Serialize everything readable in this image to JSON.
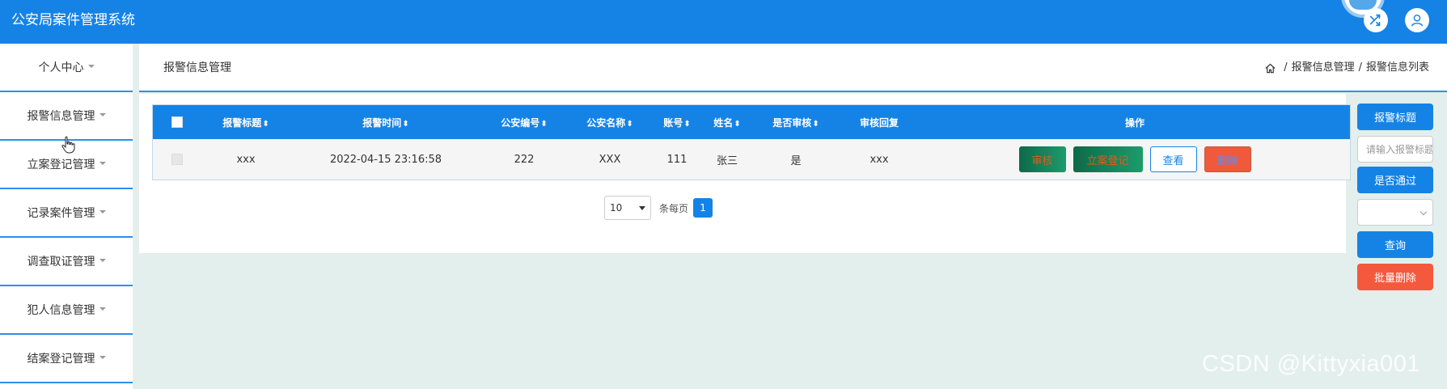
{
  "app": {
    "title": "公安局案件管理系统"
  },
  "topbar": {
    "shuffle_icon": "shuffle-icon",
    "user_icon": "user-icon"
  },
  "sidebar": {
    "items": [
      {
        "label": "个人中心"
      },
      {
        "label": "报警信息管理"
      },
      {
        "label": "立案登记管理"
      },
      {
        "label": "记录案件管理"
      },
      {
        "label": "调查取证管理"
      },
      {
        "label": "犯人信息管理"
      },
      {
        "label": "结案登记管理"
      }
    ]
  },
  "header": {
    "title": "报警信息管理",
    "breadcrumb": {
      "home_icon": "home-icon",
      "level1": "报警信息管理",
      "sep": "/",
      "level2": "报警信息列表"
    }
  },
  "table": {
    "columns": [
      "报警标题",
      "报警时间",
      "公安编号",
      "公安名称",
      "账号",
      "姓名",
      "是否审核",
      "审核回复",
      "操作"
    ],
    "rows": [
      {
        "title": "xxx",
        "time": "2022-04-15 23:16:58",
        "police_no": "222",
        "police_name": "XXX",
        "account": "111",
        "name": "张三",
        "audited": "是",
        "reply": "xxx",
        "ops": {
          "audit": "审核",
          "register": "立案登记",
          "view": "查看",
          "delete": "删除"
        }
      }
    ]
  },
  "pagination": {
    "page_size": "10",
    "per_page_label": "条每页",
    "current_page": "1"
  },
  "filters": {
    "title_label": "报警标题",
    "title_placeholder": "请输入报警标题",
    "pass_label": "是否通过",
    "pass_value": "",
    "query_button": "查询",
    "batch_delete_button": "批量删除"
  },
  "watermark": "CSDN @Kittyxia001",
  "colors": {
    "primary": "#1583e6",
    "danger": "#f5593d",
    "background": "#e3efec"
  }
}
